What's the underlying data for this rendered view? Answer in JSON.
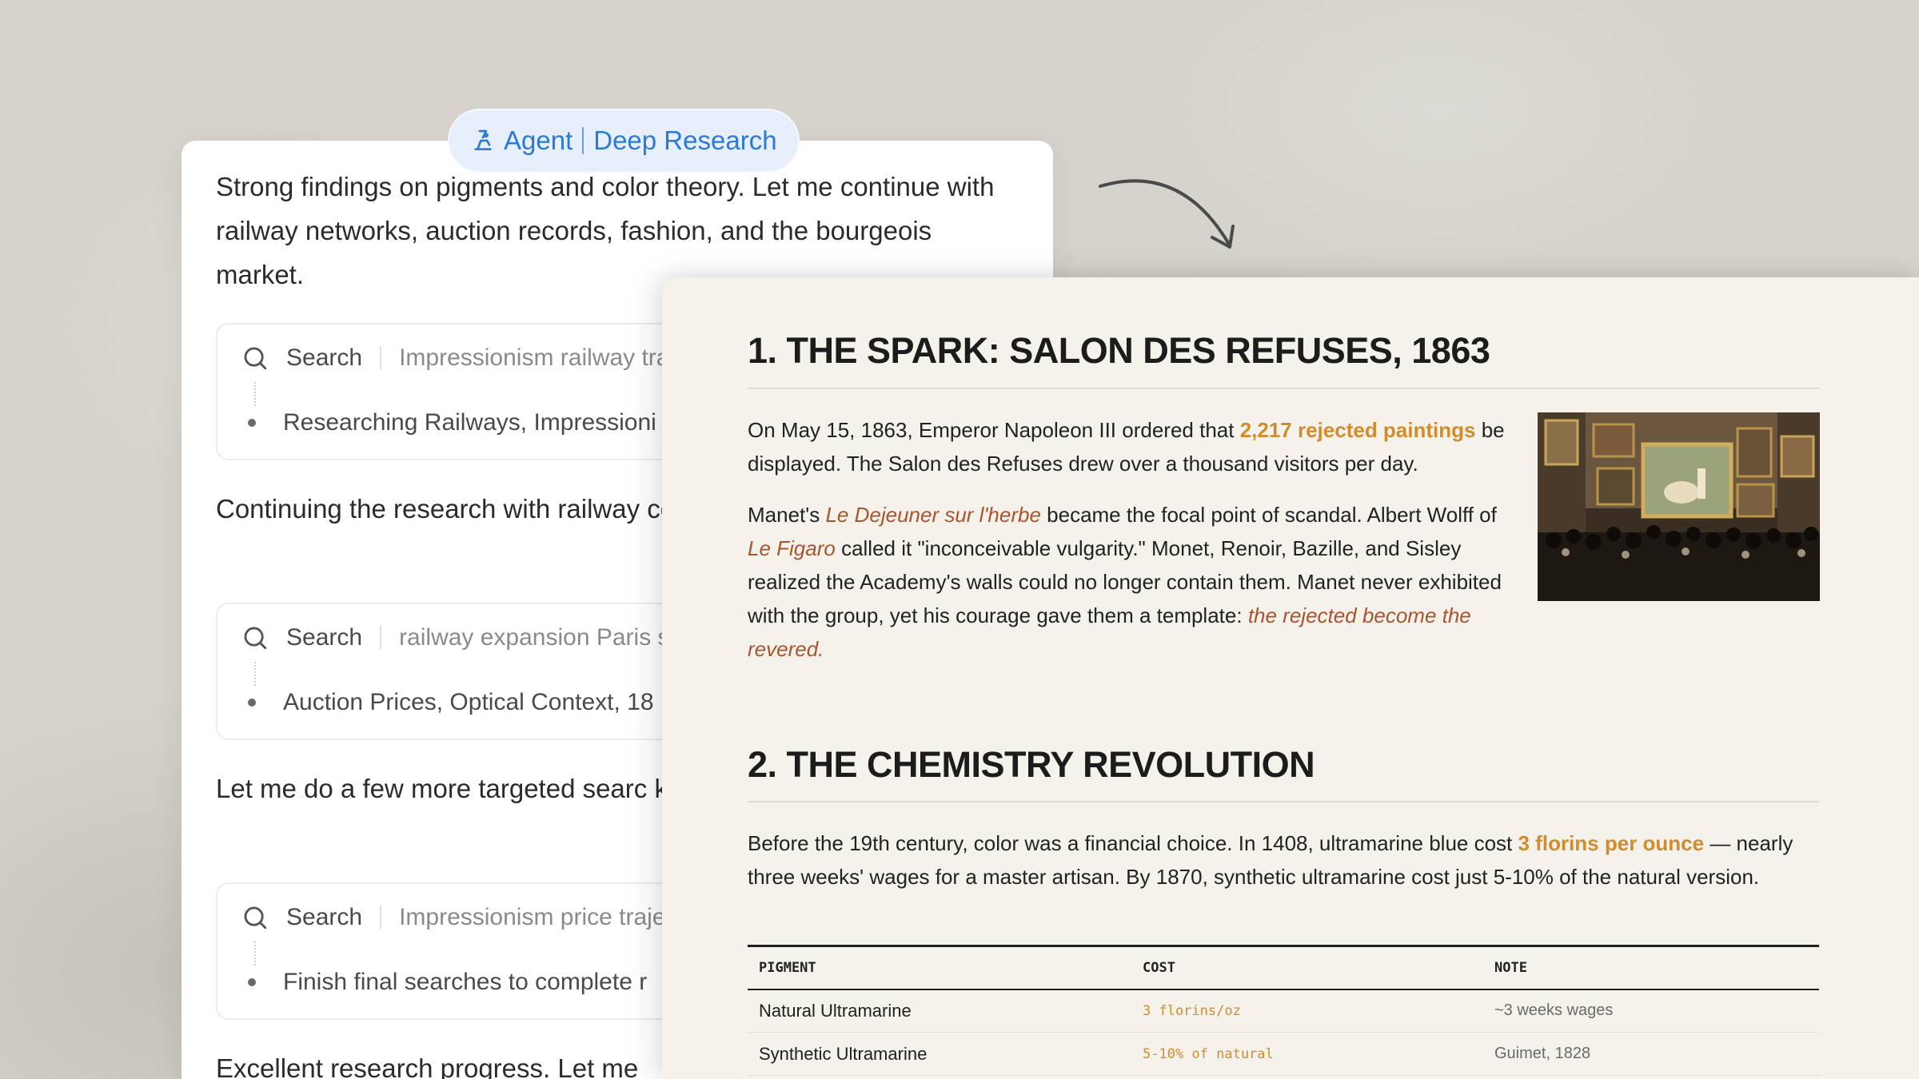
{
  "badge": {
    "agent_label": "Agent",
    "mode_label": "Deep Research",
    "icon": "agent-icon"
  },
  "chat": {
    "messages": [
      "Strong findings on pigments and color theory. Let me continue with railway networks, auction records, fashion, and the bourgeois market.",
      "Continuing the research with railway collectors.",
      "Let me do a few more targeted searc key figures.",
      "Excellent research progress. Let me"
    ],
    "searches": [
      {
        "label": "Search",
        "query": "Impressionism railway tra",
        "status": "Researching Railways, Impressioni"
      },
      {
        "label": "Search",
        "query": "railway expansion Paris s",
        "status": "Auction Prices, Optical Context, 18"
      },
      {
        "label": "Search",
        "query": "Impressionism price traje",
        "status": "Finish final searches to complete r"
      }
    ]
  },
  "report": {
    "section1": {
      "heading": "1. THE SPARK: SALON DES REFUSES, 1863",
      "p1_a": "On May 15, 1863, Emperor Napoleon III ordered that ",
      "p1_hl": "2,217 rejected paintings",
      "p1_b": " be displayed. The Salon des Refuses drew over a thousand visitors per day.",
      "p2_a": "Manet's ",
      "p2_it1": "Le Dejeuner sur l'herbe",
      "p2_b": " became the focal point of scandal. Albert Wolff of ",
      "p2_it2": "Le Figaro",
      "p2_c": " called it \"inconceivable vulgarity.\" Monet, Renoir, Bazille, and Sisley realized the Academy's walls could no longer contain them. Manet never exhibited with the group, yet his courage gave them a template: ",
      "p2_it3": "the rejected become the revered."
    },
    "section2": {
      "heading": "2. THE CHEMISTRY REVOLUTION",
      "p_a": "Before the 19th century, color was a financial choice. In 1408, ultramarine blue cost ",
      "p_hl": "3 florins per ounce",
      "p_b": " — nearly three weeks' wages for a master artisan. By 1870, synthetic ultramarine cost just 5-10% of the natural version."
    },
    "table": {
      "headers": [
        "PIGMENT",
        "COST",
        "NOTE"
      ],
      "rows": [
        {
          "pigment": "Natural Ultramarine",
          "cost": "3 florins/oz",
          "note": "~3 weeks wages"
        },
        {
          "pigment": "Synthetic Ultramarine",
          "cost": "5-10% of natural",
          "note": "Guimet, 1828"
        }
      ]
    }
  },
  "colors": {
    "accent": "#d28c2c",
    "italic_link": "#a8552f",
    "badge_blue": "#2c79d9"
  }
}
